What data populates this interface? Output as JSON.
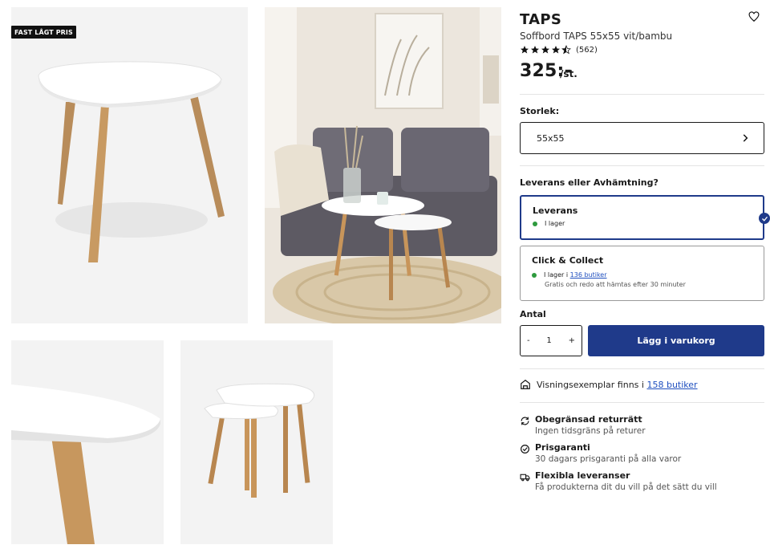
{
  "gallery": {
    "badge": "FAST LÅGT PRIS"
  },
  "product": {
    "brand": "TAPS",
    "subtitle": "Soffbord TAPS 55x55 vit/bambu",
    "rating": 4.5,
    "rating_count": "(562)",
    "price": "325:-",
    "price_unit": "/st."
  },
  "size": {
    "label": "Storlek:",
    "value": "55x55"
  },
  "delivery": {
    "label": "Leverans eller Avhämtning?",
    "options": [
      {
        "title": "Leverans",
        "stock": "I lager"
      },
      {
        "title": "Click & Collect",
        "stock_prefix": "I lager i",
        "stock_link": "136 butiker",
        "note": "Gratis och redo att hämtas efter 30 minuter"
      }
    ]
  },
  "quantity": {
    "label": "Antal",
    "minus": "-",
    "value": "1",
    "plus": "+"
  },
  "cart": {
    "add_label": "Lägg i varukorg"
  },
  "showroom": {
    "text": "Visningsexemplar finns i",
    "link": "158 butiker"
  },
  "features": [
    {
      "title": "Obegränsad returrätt",
      "text": "Ingen tidsgräns på returer"
    },
    {
      "title": "Prisgaranti",
      "text": "30 dagars prisgaranti på alla varor"
    },
    {
      "title": "Flexibla leveranser",
      "text": "Få produkterna dit du vill på det sätt du vill"
    }
  ],
  "colors": {
    "primary": "#1f3a8a",
    "stock_green": "#2e9a3e",
    "link": "#1f4fbf"
  }
}
